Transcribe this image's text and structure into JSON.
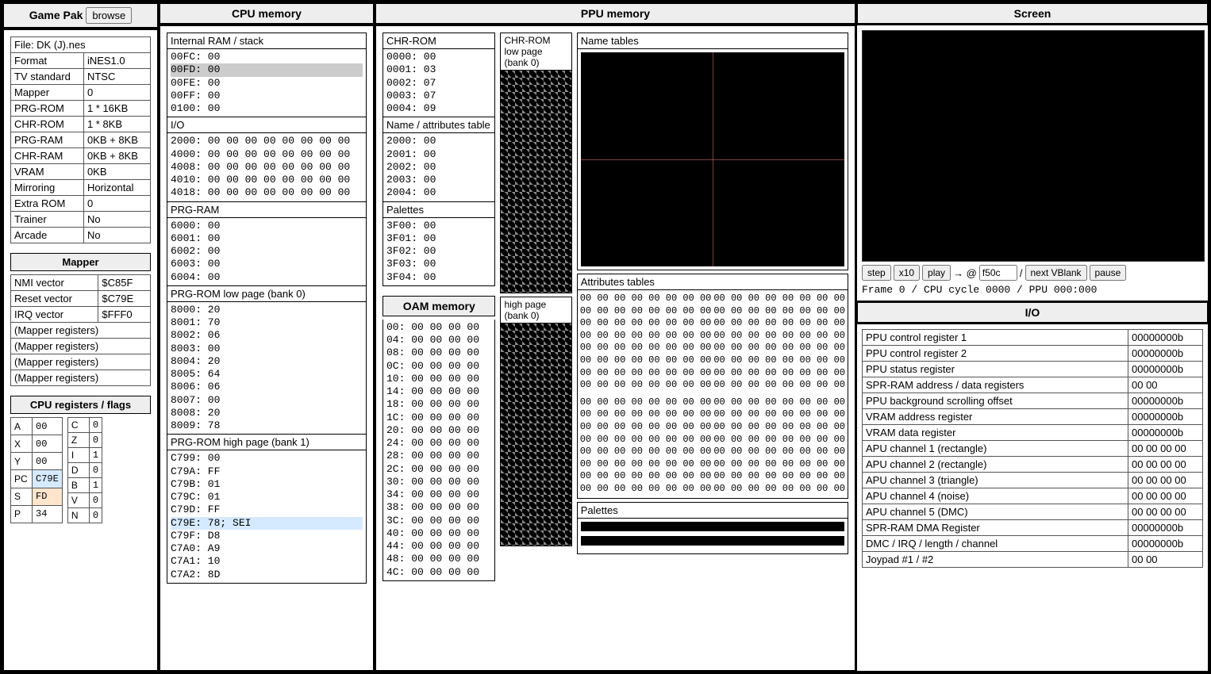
{
  "headers": {
    "gamepak": "Game Pak",
    "browse": "browse",
    "cpu_mem": "CPU memory",
    "ppu_mem": "PPU memory",
    "screen": "Screen",
    "oam_mem": "OAM memory",
    "io": "I/O"
  },
  "gamepak": {
    "file_label": "File: DK (J).nes",
    "rows": [
      [
        "Format",
        "iNES1.0"
      ],
      [
        "TV standard",
        "NTSC"
      ],
      [
        "Mapper",
        "0"
      ],
      [
        "PRG-ROM",
        "1 * 16KB"
      ],
      [
        "CHR-ROM",
        "1 * 8KB"
      ],
      [
        "PRG-RAM",
        "0KB + 8KB"
      ],
      [
        "CHR-RAM",
        "0KB + 8KB"
      ],
      [
        "VRAM",
        "0KB"
      ],
      [
        "Mirroring",
        "Horizontal"
      ],
      [
        "Extra ROM",
        "0"
      ],
      [
        "Trainer",
        "No"
      ],
      [
        "Arcade",
        "No"
      ]
    ]
  },
  "mapper": {
    "title": "Mapper",
    "rows": [
      [
        "NMI vector",
        "$C85F"
      ],
      [
        "Reset vector",
        "$C79E"
      ],
      [
        "IRQ vector",
        "$FFF0"
      ],
      [
        "(Mapper registers)",
        ""
      ],
      [
        "(Mapper registers)",
        ""
      ],
      [
        "(Mapper registers)",
        ""
      ],
      [
        "(Mapper registers)",
        ""
      ]
    ]
  },
  "cpu_regs": {
    "title": "CPU registers / flags",
    "left": [
      [
        "A",
        "00",
        ""
      ],
      [
        "X",
        "00",
        ""
      ],
      [
        "Y",
        "00",
        ""
      ],
      [
        "PC",
        "C79E",
        "hl-pc"
      ],
      [
        "S",
        "FD",
        "hl-s"
      ],
      [
        "P",
        "34",
        ""
      ]
    ],
    "right": [
      [
        "C",
        "0"
      ],
      [
        "Z",
        "0"
      ],
      [
        "I",
        "1"
      ],
      [
        "D",
        "0"
      ],
      [
        "B",
        "1"
      ],
      [
        "V",
        "0"
      ],
      [
        "N",
        "0"
      ]
    ]
  },
  "cpu_mem": {
    "ram": {
      "title": "Internal RAM / stack",
      "lines": [
        "00FC: 00",
        "00FD: 00",
        "00FE: 00",
        "00FF: 00",
        "0100: 00"
      ],
      "highlight_index": 1
    },
    "io": {
      "title": "I/O",
      "lines": [
        "2000: 00 00 00 00 00 00 00 00",
        "4000: 00 00 00 00 00 00 00 00",
        "4008: 00 00 00 00 00 00 00 00",
        "4010: 00 00 00 00 00 00 00 00",
        "4018: 00 00 00 00 00 00 00 00"
      ]
    },
    "prg_ram": {
      "title": "PRG-RAM",
      "lines": [
        "6000: 00",
        "6001: 00",
        "6002: 00",
        "6003: 00",
        "6004: 00"
      ]
    },
    "prg_low": {
      "title": "PRG-ROM low page (bank 0)",
      "lines": [
        "8000: 20",
        "8001: 70",
        "8002: 06",
        "8003: 00",
        "8004: 20",
        "8005: 64",
        "8006: 06",
        "8007: 00",
        "8008: 20",
        "8009: 78"
      ]
    },
    "prg_high": {
      "title": "PRG-ROM high page (bank 1)",
      "lines": [
        "C799: 00",
        "C79A: FF",
        "C79B: 01",
        "C79C: 01",
        "C79D: FF",
        "C79E: 78; SEI",
        "C79F: D8",
        "C7A0: A9",
        "C7A1: 10",
        "C7A2: 8D"
      ],
      "highlight_index": 5
    }
  },
  "ppu_mem": {
    "chr_rom": {
      "title": "CHR-ROM",
      "lines": [
        "0000: 00",
        "0001: 03",
        "0002: 07",
        "0003: 07",
        "0004: 09"
      ]
    },
    "nat": {
      "title": "Name / attributes table",
      "lines": [
        "2000: 00",
        "2001: 00",
        "2002: 00",
        "2003: 00",
        "2004: 00"
      ]
    },
    "palettes": {
      "title": "Palettes",
      "lines": [
        "3F00: 00",
        "3F01: 00",
        "3F02: 00",
        "3F03: 00",
        "3F04: 00"
      ]
    }
  },
  "oam": {
    "lines": [
      "00: 00 00 00 00",
      "04: 00 00 00 00",
      "08: 00 00 00 00",
      "0C: 00 00 00 00",
      "10: 00 00 00 00",
      "14: 00 00 00 00",
      "18: 00 00 00 00",
      "1C: 00 00 00 00",
      "20: 00 00 00 00",
      "24: 00 00 00 00",
      "28: 00 00 00 00",
      "2C: 00 00 00 00",
      "30: 00 00 00 00",
      "34: 00 00 00 00",
      "38: 00 00 00 00",
      "3C: 00 00 00 00",
      "40: 00 00 00 00",
      "44: 00 00 00 00",
      "48: 00 00 00 00",
      "4C: 00 00 00 00"
    ]
  },
  "chr_preview": {
    "low_title": "CHR-ROM\nlow page\n(bank 0)",
    "high_title": "high page\n(bank 0)"
  },
  "name_tables": {
    "title": "Name tables"
  },
  "attr_tables": {
    "title": "Attributes tables",
    "rows1": [
      "00 00 00 00 00 00 00 00",
      "00 00 00 00 00 00 00 00",
      "00 00 00 00 00 00 00 00",
      "00 00 00 00 00 00 00 00",
      "00 00 00 00 00 00 00 00",
      "00 00 00 00 00 00 00 00",
      "00 00 00 00 00 00 00 00",
      "00 00 00 00 00 00 00 00"
    ],
    "rows2": [
      "00 00 00 00 00 00 00 00",
      "00 00 00 00 00 00 00 00",
      "00 00 00 00 00 00 00 00",
      "00 00 00 00 00 00 00 00",
      "00 00 00 00 00 00 00 00",
      "00 00 00 00 00 00 00 00",
      "00 00 00 00 00 00 00 00",
      "00 00 00 00 00 00 00 00"
    ]
  },
  "palette_panel": {
    "title": "Palettes"
  },
  "screen": {
    "step": "step",
    "x10": "x10",
    "play": "play",
    "arrow": "→ @",
    "addr": "f50c",
    "slash": "/",
    "next_vblank": "next VBlank",
    "pause": "pause",
    "frame_info": "Frame 0 / CPU cycle 0000 / PPU 000:000"
  },
  "io": {
    "rows": [
      [
        "PPU control register 1",
        "00000000b"
      ],
      [
        "PPU control register 2",
        "00000000b"
      ],
      [
        "PPU status register",
        "00000000b"
      ],
      [
        "SPR-RAM address / data registers",
        "00 00"
      ],
      [
        "PPU background scrolling offset",
        "00000000b"
      ],
      [
        "VRAM address register",
        "00000000b"
      ],
      [
        "VRAM data register",
        "00000000b"
      ],
      [
        "APU channel 1 (rectangle)",
        "00 00 00 00"
      ],
      [
        "APU channel 2 (rectangle)",
        "00 00 00 00"
      ],
      [
        "APU channel 3 (triangle)",
        "00 00 00 00"
      ],
      [
        "APU channel 4 (noise)",
        "00 00 00 00"
      ],
      [
        "APU channel 5 (DMC)",
        "00 00 00 00"
      ],
      [
        "SPR-RAM DMA Register",
        "00000000b"
      ],
      [
        "DMC / IRQ / length / channel",
        "00000000b"
      ],
      [
        "Joypad #1 / #2",
        "00 00"
      ]
    ]
  }
}
